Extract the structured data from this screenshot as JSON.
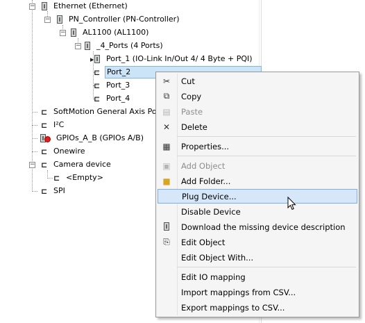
{
  "tree": {
    "ethernet": "Ethernet (Ethernet)",
    "pn_controller": "PN_Controller (PN-Controller)",
    "al1100": "AL1100 (AL1100)",
    "four_ports": "_4_Ports (4 Ports)",
    "port_1": "Port_1 (IO-Link In/Out  4/ 4 Byte + PQI)",
    "port_2": "Port_2",
    "port_3": "Port_3",
    "port_4": "Port_4",
    "softmotion": "SoftMotion General Axis Pool",
    "i2c": "I²C",
    "gpios": "GPIOs_A_B (GPIOs A/B)",
    "onewire": "Onewire",
    "camera": "Camera device",
    "empty": "<Empty>",
    "spi": "SPI"
  },
  "menu": {
    "cut": "Cut",
    "copy": "Copy",
    "paste": "Paste",
    "delete": "Delete",
    "properties": "Properties...",
    "add_object": "Add Object",
    "add_folder": "Add Folder...",
    "plug_device": "Plug Device...",
    "disable_device": "Disable Device",
    "download_desc": "Download the missing device description",
    "edit_object": "Edit Object",
    "edit_object_with": "Edit Object With...",
    "edit_io_mapping": "Edit IO mapping",
    "import_csv": "Import mappings from CSV...",
    "export_csv": "Export mappings to CSV..."
  },
  "icons": {
    "cut": "scissors-icon",
    "copy": "copy-icon",
    "paste": "paste-icon",
    "delete": "delete-icon",
    "properties": "properties-icon",
    "add_object": "add-object-icon",
    "add_folder": "folder-icon",
    "download": "device-icon",
    "edit_object": "edit-object-icon"
  },
  "colors": {
    "selection": "#cce4f7",
    "menu_highlight": "#d5e7f8",
    "menu_background": "#f5f5f5"
  }
}
